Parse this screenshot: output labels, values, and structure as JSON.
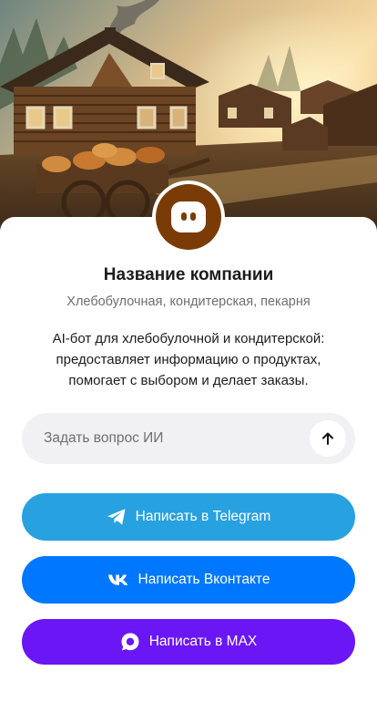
{
  "company": {
    "name": "Название компании",
    "category": "Хлебобулочная, кондитерская, пекарня",
    "description": "AI-бот для хлебобулочной и кондитерской: предоставляет информацию о продуктах, помогает с выбором и делает заказы."
  },
  "ask": {
    "placeholder": "Задать вопрос ИИ"
  },
  "buttons": {
    "telegram": "Написать в Telegram",
    "vk": "Написать Вконтакте",
    "max": "Написать в MAX"
  },
  "colors": {
    "avatar": "#7b3b06",
    "telegram": "#27a1e0",
    "vk": "#0077ff",
    "max": "#6a16f5"
  },
  "icons": {
    "avatar": "bot-icon",
    "send": "arrow-up-icon",
    "telegram": "telegram-icon",
    "vk": "vk-icon",
    "max": "max-icon"
  }
}
